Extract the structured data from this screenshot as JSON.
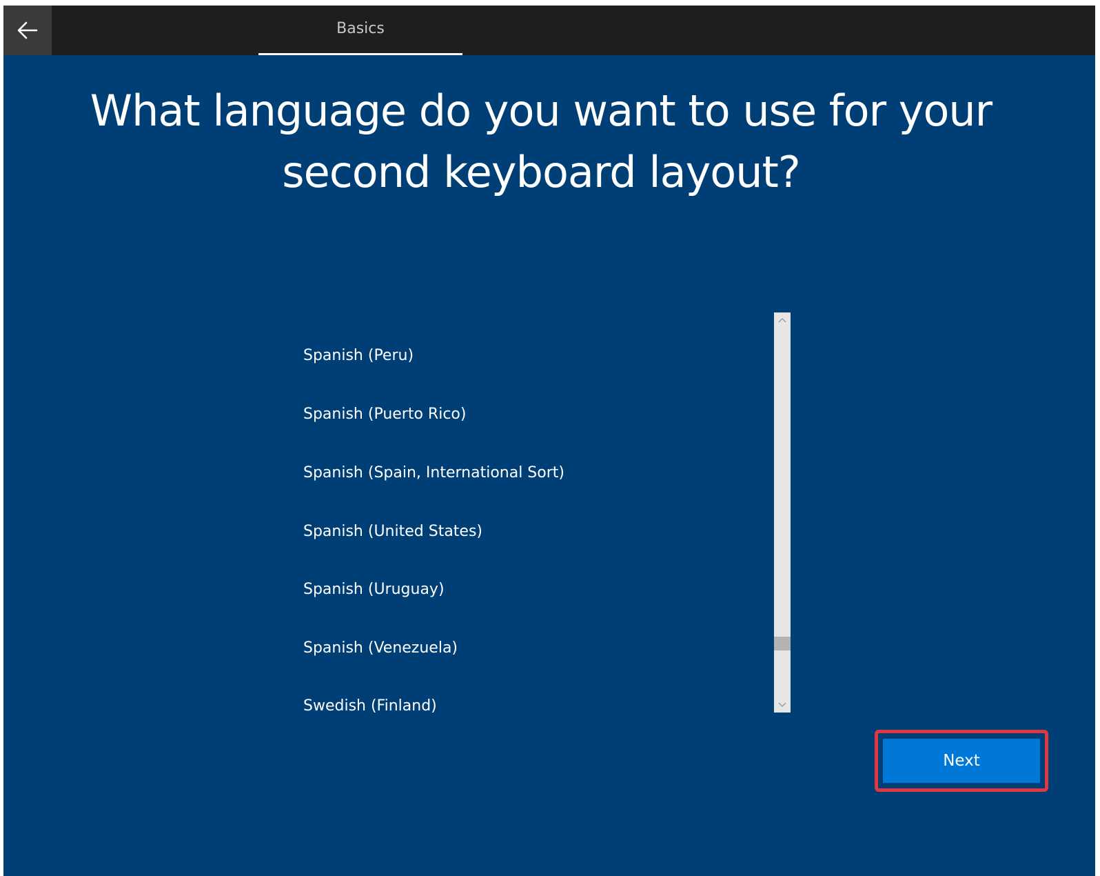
{
  "header": {
    "back_icon": "arrow-left-icon",
    "tab_label": "Basics"
  },
  "main": {
    "heading_line1": "What language do you want to use for your",
    "heading_line2": "second keyboard layout?",
    "languages": [
      "Spanish (Peru)",
      "Spanish (Puerto Rico)",
      "Spanish (Spain, International Sort)",
      "Spanish (United States)",
      "Spanish (Uruguay)",
      "Spanish (Venezuela)",
      "Swedish (Finland)"
    ]
  },
  "footer": {
    "next_label": "Next"
  },
  "colors": {
    "background": "#003f75",
    "topbar": "#1e1e1e",
    "accent": "#0078d7",
    "highlight": "#e0383e"
  }
}
